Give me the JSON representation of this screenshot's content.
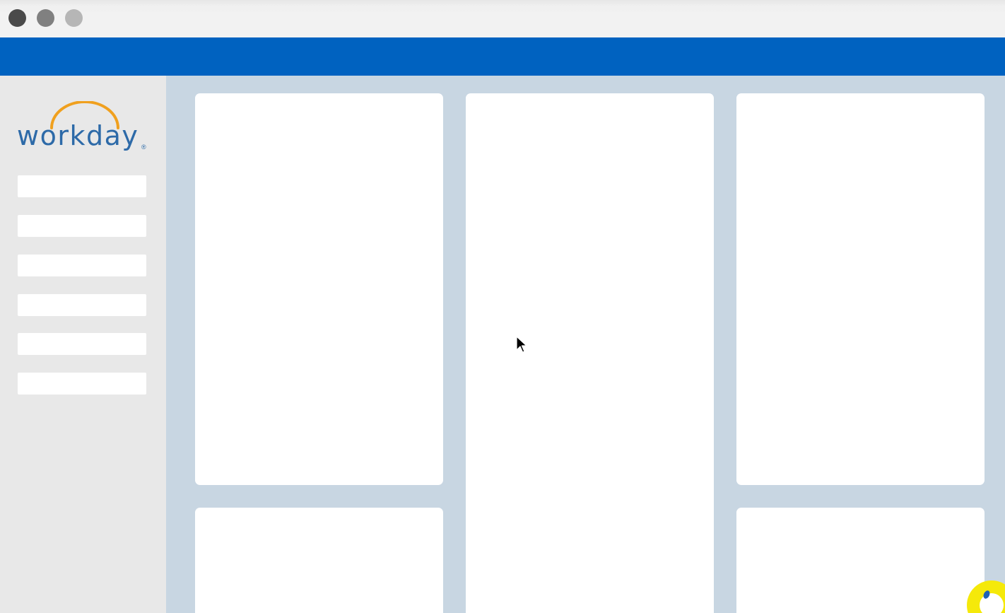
{
  "window": {
    "controls": [
      "close",
      "minimize",
      "maximize"
    ]
  },
  "sidebar": {
    "logo": {
      "text": "workday",
      "registered_mark": "®",
      "arc_color": "#f0a01e",
      "text_color": "#2d6aa8"
    },
    "nav_items": [
      {
        "label": ""
      },
      {
        "label": ""
      },
      {
        "label": ""
      },
      {
        "label": ""
      },
      {
        "label": ""
      },
      {
        "label": ""
      }
    ]
  },
  "colors": {
    "header_blue": "#0062c0",
    "sidebar_bg": "#e8e8e8",
    "main_bg": "#c8d6e2",
    "card_bg": "#ffffff",
    "badge_yellow": "#f5e90a"
  },
  "icons": {
    "cursor": "arrow-cursor-icon",
    "badge": "assistant-badge-icon"
  }
}
